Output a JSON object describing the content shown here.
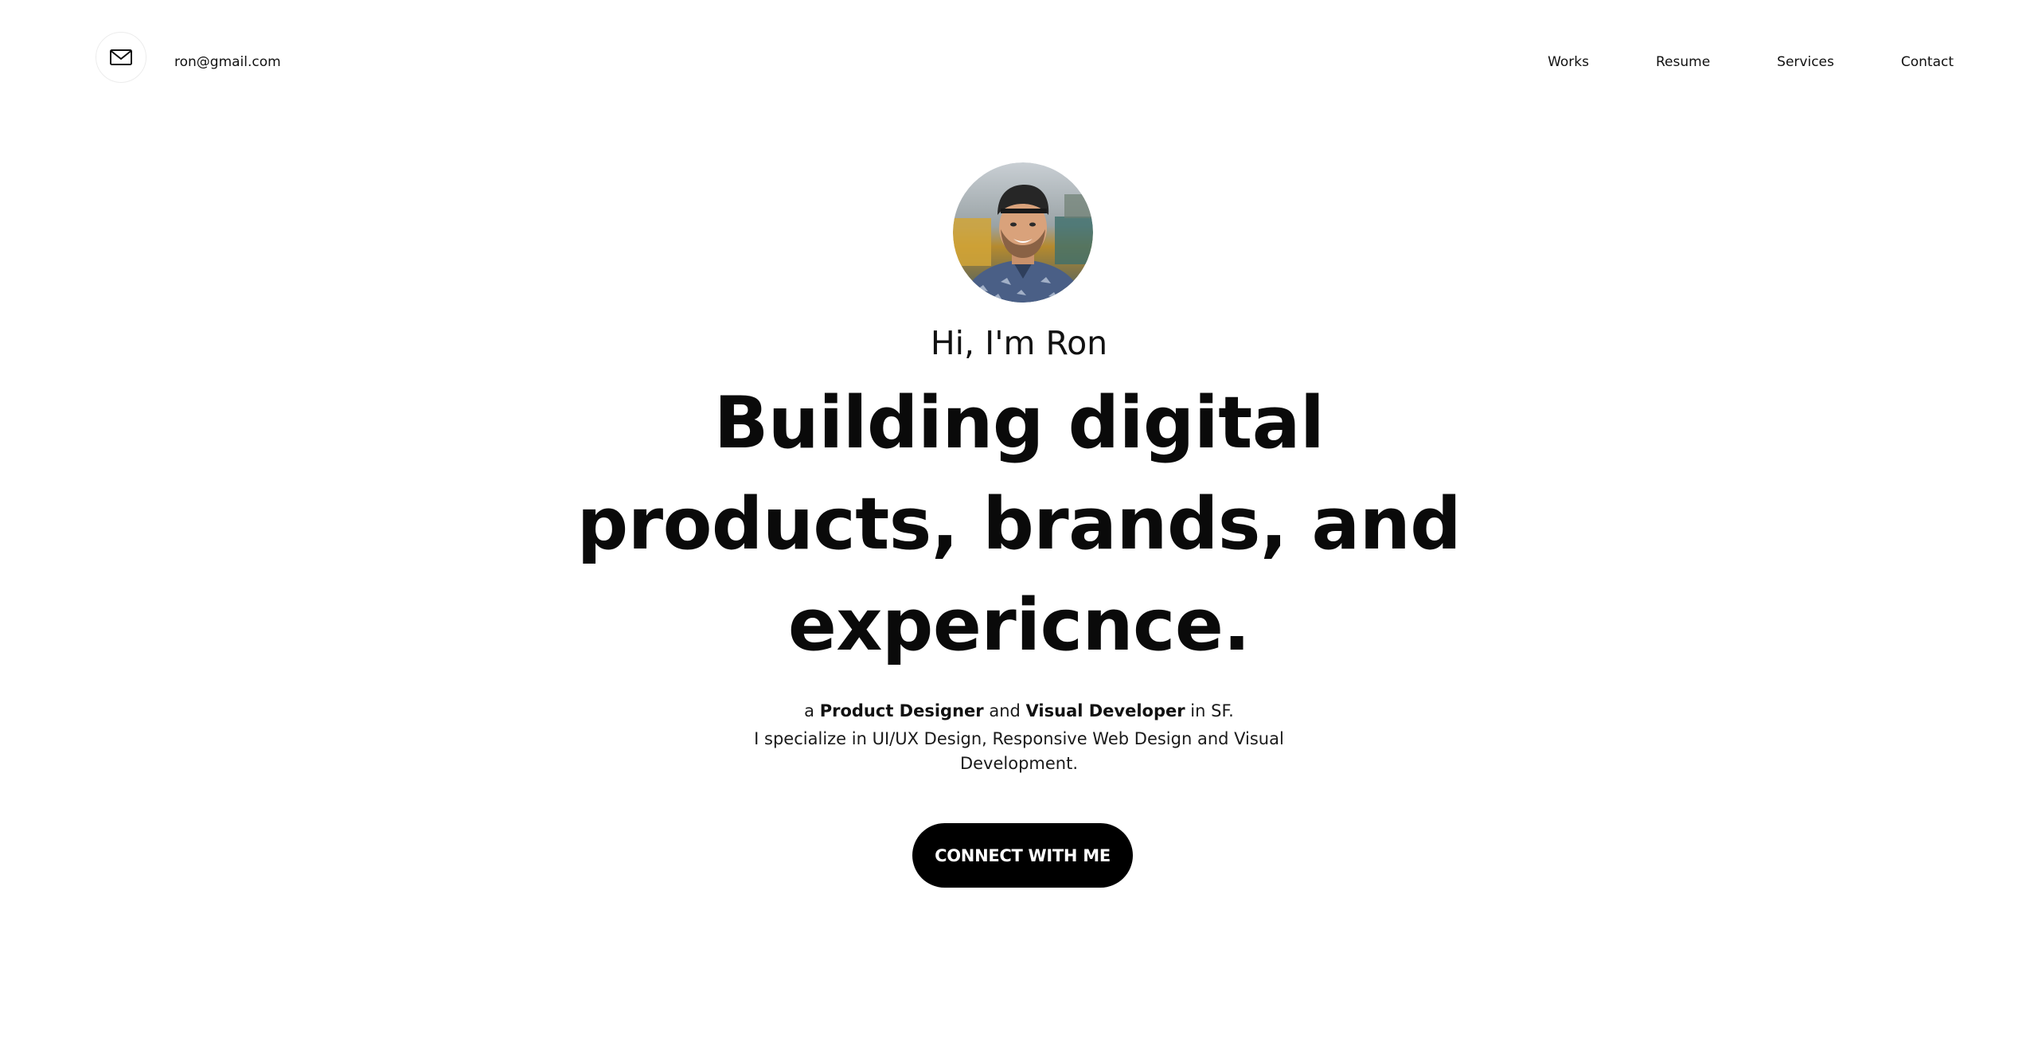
{
  "header": {
    "mail_icon": "envelope-icon",
    "email": "ron@gmail.com",
    "nav": [
      {
        "label": "Works"
      },
      {
        "label": "Resume"
      },
      {
        "label": "Services"
      },
      {
        "label": "Contact"
      }
    ]
  },
  "hero": {
    "greeting": "Hi, I'm Ron",
    "headline_line1": "Building digital",
    "headline_line2": "products, brands, and",
    "headline_line3": "expericnce.",
    "intro": {
      "prefix": "a",
      "role1": "Product Designer",
      "and": "and",
      "role2": "Visual Developer",
      "location": "in SF.",
      "specialty": "I specialize in UI/UX Design, Responsive Web Design and Visual Development."
    },
    "cta_label": "CONNECT WITH ME"
  },
  "colors": {
    "background": "#ffffff",
    "text": "#111111",
    "button": "#000000",
    "button_text": "#ffffff"
  }
}
